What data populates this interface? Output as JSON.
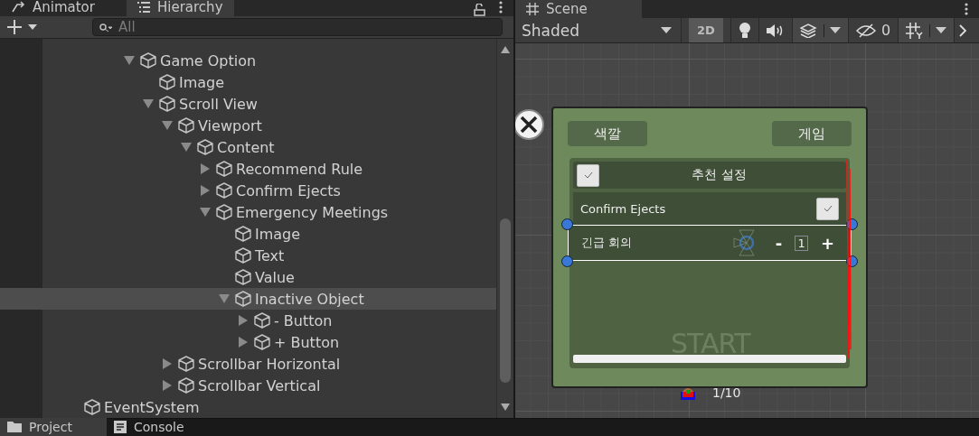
{
  "left_tabs": [
    {
      "label": "Animator",
      "selected": false
    },
    {
      "label": "Hierarchy",
      "selected": true
    }
  ],
  "hierarchy": {
    "search": {
      "placeholder": "All"
    },
    "tree": [
      {
        "label": "Game Option",
        "expanded": true,
        "selected": false,
        "children": [
          {
            "label": "Image",
            "selected": false
          },
          {
            "label": "Scroll View",
            "expanded": true,
            "selected": false,
            "children": [
              {
                "label": "Viewport",
                "expanded": true,
                "selected": false,
                "children": [
                  {
                    "label": "Content",
                    "expanded": true,
                    "selected": false,
                    "children": [
                      {
                        "label": "Recommend Rule",
                        "expanded": false,
                        "selected": false
                      },
                      {
                        "label": "Confirm Ejects",
                        "expanded": false,
                        "selected": false
                      },
                      {
                        "label": "Emergency Meetings",
                        "expanded": true,
                        "selected": false,
                        "children": [
                          {
                            "label": "Image",
                            "selected": false
                          },
                          {
                            "label": "Text",
                            "selected": false
                          },
                          {
                            "label": "Value",
                            "selected": false
                          },
                          {
                            "label": "Inactive Object",
                            "expanded": true,
                            "selected": true,
                            "children": [
                              {
                                "label": "- Button",
                                "expanded": false,
                                "selected": false
                              },
                              {
                                "label": "+ Button",
                                "expanded": false,
                                "selected": false
                              }
                            ]
                          }
                        ]
                      }
                    ]
                  }
                ]
              },
              {
                "label": "Scrollbar Horizontal",
                "expanded": false,
                "selected": false
              },
              {
                "label": "Scrollbar Vertical",
                "expanded": false,
                "selected": false
              }
            ]
          }
        ]
      }
    ],
    "roots": [
      {
        "label": "EventSystem",
        "selected": false
      }
    ]
  },
  "scene_tab": {
    "label": "Scene"
  },
  "scene_toolbar": {
    "shading": "Shaded",
    "mode_2d": {
      "label": "2D",
      "on": true
    },
    "hidden_count": "0"
  },
  "game_canvas": {
    "tabs": [
      "색깔",
      "게임"
    ],
    "rows": [
      {
        "kind": "header",
        "label": "추천 설정",
        "checked": true
      },
      {
        "kind": "toggle",
        "label": "Confirm Ejects",
        "checked": true
      },
      {
        "kind": "stepper",
        "label": "긴급 회의",
        "minus": "-",
        "value": "1",
        "plus": "+"
      }
    ],
    "start_label": "START",
    "page": "1/10"
  },
  "bottom_tabs": [
    {
      "label": "Project",
      "selected": true
    },
    {
      "label": "Console",
      "selected": false
    }
  ]
}
